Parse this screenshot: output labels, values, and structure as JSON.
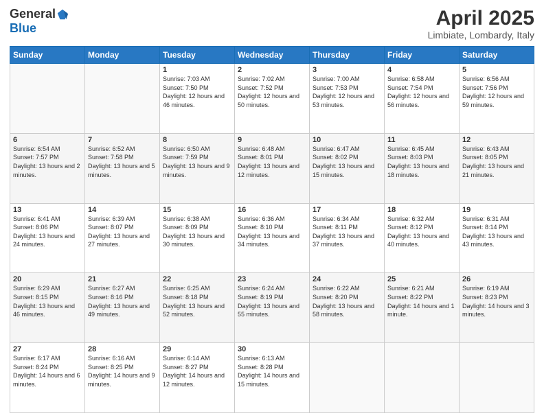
{
  "header": {
    "logo_general": "General",
    "logo_blue": "Blue",
    "month": "April 2025",
    "location": "Limbiate, Lombardy, Italy"
  },
  "weekdays": [
    "Sunday",
    "Monday",
    "Tuesday",
    "Wednesday",
    "Thursday",
    "Friday",
    "Saturday"
  ],
  "weeks": [
    [
      {
        "day": "",
        "sunrise": "",
        "sunset": "",
        "daylight": ""
      },
      {
        "day": "",
        "sunrise": "",
        "sunset": "",
        "daylight": ""
      },
      {
        "day": "1",
        "sunrise": "Sunrise: 7:03 AM",
        "sunset": "Sunset: 7:50 PM",
        "daylight": "Daylight: 12 hours and 46 minutes."
      },
      {
        "day": "2",
        "sunrise": "Sunrise: 7:02 AM",
        "sunset": "Sunset: 7:52 PM",
        "daylight": "Daylight: 12 hours and 50 minutes."
      },
      {
        "day": "3",
        "sunrise": "Sunrise: 7:00 AM",
        "sunset": "Sunset: 7:53 PM",
        "daylight": "Daylight: 12 hours and 53 minutes."
      },
      {
        "day": "4",
        "sunrise": "Sunrise: 6:58 AM",
        "sunset": "Sunset: 7:54 PM",
        "daylight": "Daylight: 12 hours and 56 minutes."
      },
      {
        "day": "5",
        "sunrise": "Sunrise: 6:56 AM",
        "sunset": "Sunset: 7:56 PM",
        "daylight": "Daylight: 12 hours and 59 minutes."
      }
    ],
    [
      {
        "day": "6",
        "sunrise": "Sunrise: 6:54 AM",
        "sunset": "Sunset: 7:57 PM",
        "daylight": "Daylight: 13 hours and 2 minutes."
      },
      {
        "day": "7",
        "sunrise": "Sunrise: 6:52 AM",
        "sunset": "Sunset: 7:58 PM",
        "daylight": "Daylight: 13 hours and 5 minutes."
      },
      {
        "day": "8",
        "sunrise": "Sunrise: 6:50 AM",
        "sunset": "Sunset: 7:59 PM",
        "daylight": "Daylight: 13 hours and 9 minutes."
      },
      {
        "day": "9",
        "sunrise": "Sunrise: 6:48 AM",
        "sunset": "Sunset: 8:01 PM",
        "daylight": "Daylight: 13 hours and 12 minutes."
      },
      {
        "day": "10",
        "sunrise": "Sunrise: 6:47 AM",
        "sunset": "Sunset: 8:02 PM",
        "daylight": "Daylight: 13 hours and 15 minutes."
      },
      {
        "day": "11",
        "sunrise": "Sunrise: 6:45 AM",
        "sunset": "Sunset: 8:03 PM",
        "daylight": "Daylight: 13 hours and 18 minutes."
      },
      {
        "day": "12",
        "sunrise": "Sunrise: 6:43 AM",
        "sunset": "Sunset: 8:05 PM",
        "daylight": "Daylight: 13 hours and 21 minutes."
      }
    ],
    [
      {
        "day": "13",
        "sunrise": "Sunrise: 6:41 AM",
        "sunset": "Sunset: 8:06 PM",
        "daylight": "Daylight: 13 hours and 24 minutes."
      },
      {
        "day": "14",
        "sunrise": "Sunrise: 6:39 AM",
        "sunset": "Sunset: 8:07 PM",
        "daylight": "Daylight: 13 hours and 27 minutes."
      },
      {
        "day": "15",
        "sunrise": "Sunrise: 6:38 AM",
        "sunset": "Sunset: 8:09 PM",
        "daylight": "Daylight: 13 hours and 30 minutes."
      },
      {
        "day": "16",
        "sunrise": "Sunrise: 6:36 AM",
        "sunset": "Sunset: 8:10 PM",
        "daylight": "Daylight: 13 hours and 34 minutes."
      },
      {
        "day": "17",
        "sunrise": "Sunrise: 6:34 AM",
        "sunset": "Sunset: 8:11 PM",
        "daylight": "Daylight: 13 hours and 37 minutes."
      },
      {
        "day": "18",
        "sunrise": "Sunrise: 6:32 AM",
        "sunset": "Sunset: 8:12 PM",
        "daylight": "Daylight: 13 hours and 40 minutes."
      },
      {
        "day": "19",
        "sunrise": "Sunrise: 6:31 AM",
        "sunset": "Sunset: 8:14 PM",
        "daylight": "Daylight: 13 hours and 43 minutes."
      }
    ],
    [
      {
        "day": "20",
        "sunrise": "Sunrise: 6:29 AM",
        "sunset": "Sunset: 8:15 PM",
        "daylight": "Daylight: 13 hours and 46 minutes."
      },
      {
        "day": "21",
        "sunrise": "Sunrise: 6:27 AM",
        "sunset": "Sunset: 8:16 PM",
        "daylight": "Daylight: 13 hours and 49 minutes."
      },
      {
        "day": "22",
        "sunrise": "Sunrise: 6:25 AM",
        "sunset": "Sunset: 8:18 PM",
        "daylight": "Daylight: 13 hours and 52 minutes."
      },
      {
        "day": "23",
        "sunrise": "Sunrise: 6:24 AM",
        "sunset": "Sunset: 8:19 PM",
        "daylight": "Daylight: 13 hours and 55 minutes."
      },
      {
        "day": "24",
        "sunrise": "Sunrise: 6:22 AM",
        "sunset": "Sunset: 8:20 PM",
        "daylight": "Daylight: 13 hours and 58 minutes."
      },
      {
        "day": "25",
        "sunrise": "Sunrise: 6:21 AM",
        "sunset": "Sunset: 8:22 PM",
        "daylight": "Daylight: 14 hours and 1 minute."
      },
      {
        "day": "26",
        "sunrise": "Sunrise: 6:19 AM",
        "sunset": "Sunset: 8:23 PM",
        "daylight": "Daylight: 14 hours and 3 minutes."
      }
    ],
    [
      {
        "day": "27",
        "sunrise": "Sunrise: 6:17 AM",
        "sunset": "Sunset: 8:24 PM",
        "daylight": "Daylight: 14 hours and 6 minutes."
      },
      {
        "day": "28",
        "sunrise": "Sunrise: 6:16 AM",
        "sunset": "Sunset: 8:25 PM",
        "daylight": "Daylight: 14 hours and 9 minutes."
      },
      {
        "day": "29",
        "sunrise": "Sunrise: 6:14 AM",
        "sunset": "Sunset: 8:27 PM",
        "daylight": "Daylight: 14 hours and 12 minutes."
      },
      {
        "day": "30",
        "sunrise": "Sunrise: 6:13 AM",
        "sunset": "Sunset: 8:28 PM",
        "daylight": "Daylight: 14 hours and 15 minutes."
      },
      {
        "day": "",
        "sunrise": "",
        "sunset": "",
        "daylight": ""
      },
      {
        "day": "",
        "sunrise": "",
        "sunset": "",
        "daylight": ""
      },
      {
        "day": "",
        "sunrise": "",
        "sunset": "",
        "daylight": ""
      }
    ]
  ]
}
